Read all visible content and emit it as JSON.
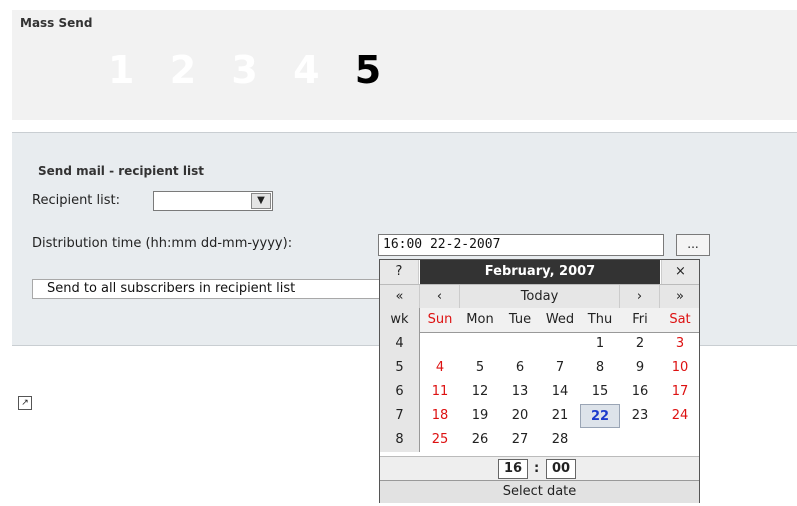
{
  "module_title": "Mass Send",
  "steps": [
    "1",
    "2",
    "3",
    "4",
    "5"
  ],
  "active_step": 5,
  "form": {
    "section_title": "Send mail - recipient list",
    "recipient_label": "Recipient list:",
    "recipient_value": "",
    "distribution_label": "Distribution time (hh:mm dd-mm-yyyy):",
    "distribution_value": "16:00 22-2-2007",
    "date_button_label": "...",
    "send_button_label": "Send to all subscribers in recipient list"
  },
  "icons": {
    "select_arrow": "chevron-down-icon",
    "popout": "popout-icon"
  },
  "calendar": {
    "help": "?",
    "title": "February, 2007",
    "close": "×",
    "prev_year": "«",
    "prev_month": "‹",
    "today": "Today",
    "next_month": "›",
    "next_year": "»",
    "weekdays": [
      "wk",
      "Sun",
      "Mon",
      "Tue",
      "Wed",
      "Thu",
      "Fri",
      "Sat"
    ],
    "weeks": [
      {
        "wk": "4",
        "days": [
          "",
          "",
          "",
          "",
          "1",
          "2",
          "3"
        ]
      },
      {
        "wk": "5",
        "days": [
          "4",
          "5",
          "6",
          "7",
          "8",
          "9",
          "10"
        ]
      },
      {
        "wk": "6",
        "days": [
          "11",
          "12",
          "13",
          "14",
          "15",
          "16",
          "17"
        ]
      },
      {
        "wk": "7",
        "days": [
          "18",
          "19",
          "20",
          "21",
          "22",
          "23",
          "24"
        ]
      },
      {
        "wk": "8",
        "days": [
          "25",
          "26",
          "27",
          "28",
          "",
          "",
          ""
        ]
      }
    ],
    "selected_day": "22",
    "hour": "16",
    "minute": "00",
    "time_separator": ":",
    "footer": "Select date"
  },
  "colors": {
    "weekend": "#dd1111",
    "selected_day_text": "#1c3ccc",
    "title_bar": "#333333"
  }
}
